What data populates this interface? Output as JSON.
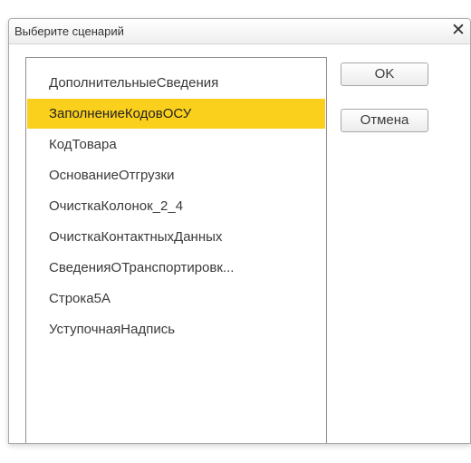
{
  "dialog": {
    "title": "Выберите сценарий",
    "close_glyph": "✕"
  },
  "list": {
    "items": [
      {
        "label": "ДополнительныеСведения"
      },
      {
        "label": "ЗаполнениеКодовОСУ",
        "selected": true
      },
      {
        "label": "КодТовара"
      },
      {
        "label": "ОснованиеОтгрузки"
      },
      {
        "label": "ОчисткаКолонок_2_4"
      },
      {
        "label": "ОчисткаКонтактныхДанных"
      },
      {
        "label": "СведенияОТранспортировк..."
      },
      {
        "label": "Строка5А"
      },
      {
        "label": "УступочнаяНадпись"
      }
    ]
  },
  "buttons": {
    "ok": "OK",
    "cancel": "Отмена"
  },
  "colors": {
    "selection": "#fbd01d",
    "text": "#3a3a3a",
    "border": "#8e8e8e"
  },
  "icons": {
    "close": "close-icon"
  }
}
